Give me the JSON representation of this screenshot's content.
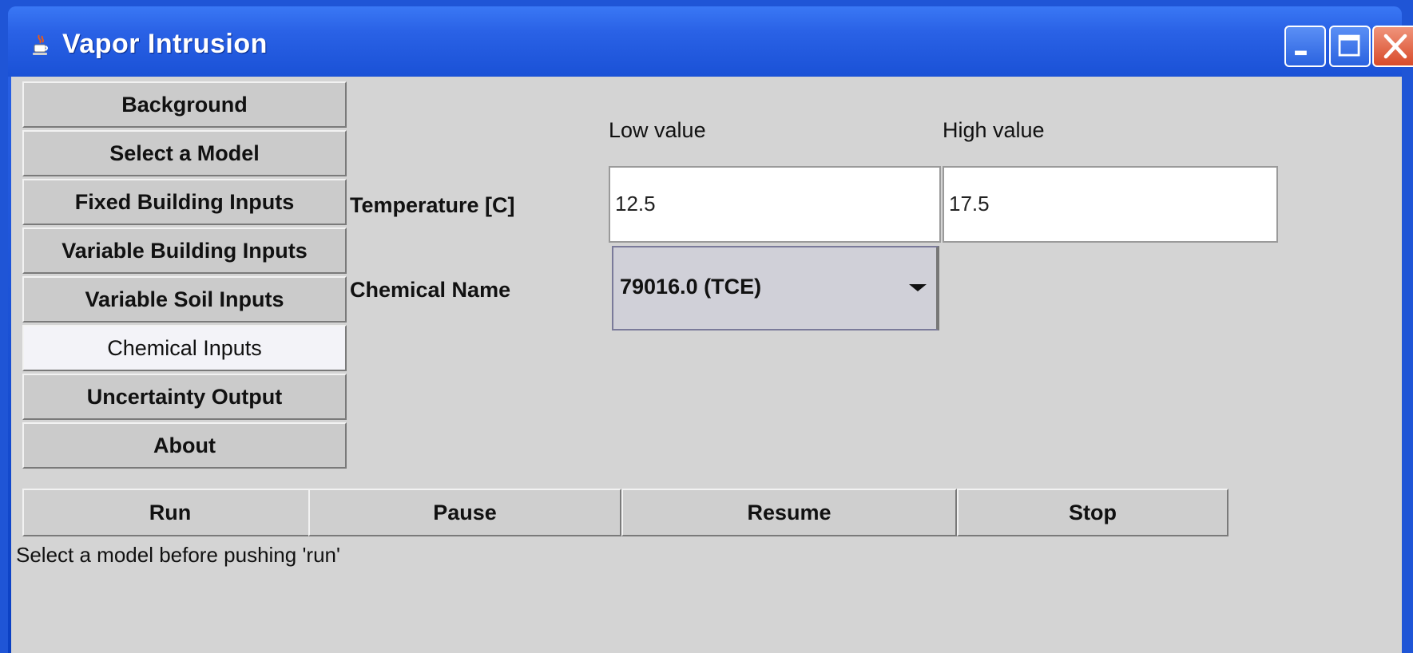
{
  "window": {
    "title": "Vapor Intrusion",
    "icon": "java-cup-icon",
    "controls": {
      "minimize": "minimize-icon",
      "maximize": "maximize-icon",
      "close": "close-icon"
    }
  },
  "sidebar": {
    "items": [
      {
        "label": "Background",
        "selected": false
      },
      {
        "label": "Select a Model",
        "selected": false
      },
      {
        "label": "Fixed Building Inputs",
        "selected": false
      },
      {
        "label": "Variable Building Inputs",
        "selected": false
      },
      {
        "label": "Variable Soil Inputs",
        "selected": false
      },
      {
        "label": "Chemical Inputs",
        "selected": true
      },
      {
        "label": "Uncertainty Output",
        "selected": false
      },
      {
        "label": "About",
        "selected": false
      }
    ]
  },
  "form": {
    "low_header": "Low value",
    "high_header": "High value",
    "temperature_label": "Temperature [C]",
    "temperature_low": "12.5",
    "temperature_high": "17.5",
    "chemical_label": "Chemical Name",
    "chemical_value": "79016.0 (TCE)"
  },
  "actions": {
    "run": "Run",
    "pause": "Pause",
    "resume": "Resume",
    "stop": "Stop"
  },
  "status": "Select a model before pushing 'run'"
}
